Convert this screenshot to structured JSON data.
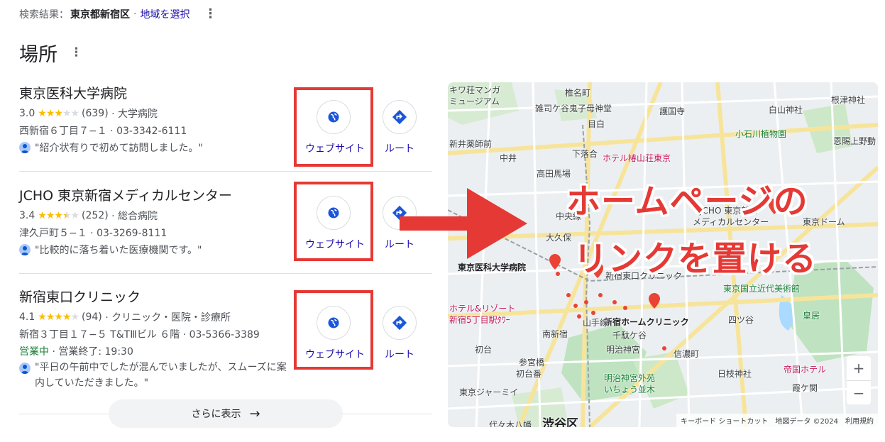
{
  "header": {
    "prefix": "検索結果：",
    "location": "東京都新宿区",
    "separator": "·",
    "region_link": "地域を選択"
  },
  "section": {
    "title": "場所"
  },
  "places": [
    {
      "name": "東京医科大学病院",
      "rating": "3.0",
      "stars": 3.0,
      "reviews": "(639)",
      "category": "· 大学病院",
      "address": "西新宿６丁目７−１ · 03-3342-6111",
      "review": "\"紹介状有りで初めて訪問しました。\""
    },
    {
      "name": "JCHO 東京新宿メディカルセンター",
      "rating": "3.4",
      "stars": 3.5,
      "reviews": "(252)",
      "category": "· 総合病院",
      "address": "津久戸町５−１ · 03-3269-8111",
      "review": "\"比較的に落ち着いた医療機関です。\""
    },
    {
      "name": "新宿東口クリニック",
      "rating": "4.1",
      "stars": 4.0,
      "reviews": "(94)",
      "category": "· クリニック・医院・診療所",
      "address": "新宿３丁目１７−５ T&TⅢビル ６階 · 03-5366-3389",
      "open_status": "営業中",
      "hours": "· 営業終了: 19:30",
      "review": "\"平日の午前中でしたが混んでいましたが、スムーズに案内していただきました。\""
    }
  ],
  "actions": {
    "website": "ウェブサイト",
    "route": "ルート"
  },
  "more": {
    "label": "さらに表示"
  },
  "callout": {
    "line1": "ホームページの",
    "line2": "リンクを置ける"
  },
  "map": {
    "labels": {
      "l01": "キワ荘マンガ",
      "l02": "ミュージアム",
      "l03": "椎名町",
      "l04": "雑司ケ谷鬼子母神堂",
      "l05": "護国寺",
      "l06": "白山神社",
      "l07": "根津神社",
      "l08": "目白",
      "l09": "小石川植物園",
      "l10": "恩賜上野動",
      "l11": "新井薬師前",
      "l12": "中井",
      "l13": "下落合",
      "l14": "ホテル椿山荘東京",
      "l15": "高田馬場",
      "l16": "JCHO 東京新宿",
      "l17": "メディカルセンター",
      "l18": "東京ドーム",
      "l19": "大久保",
      "l20": "東京医科大学病院",
      "l21": "新宿東口クリニック",
      "l22": "東京国立近代美術館",
      "l23": "ホテル&リゾート",
      "l24": "新宿5丁目駅ﾀﾜｰ",
      "l25": "新宿ホームクリニック",
      "l26": "四ツ谷",
      "l27": "南新宿",
      "l28": "千駄ケ谷",
      "l29": "皇居",
      "l30": "初台",
      "l31": "明治神宮",
      "l32": "信濃町",
      "l33": "参宮橋",
      "l34": "初台番",
      "l35": "明治神宮外苑",
      "l36": "いちょう並木",
      "l37": "日枝神社",
      "l38": "帝国ホテル",
      "l39": "東京ジャーミイ",
      "l40": "霞ケ関",
      "l41": "渋谷区",
      "l42": "代々木八幡",
      "l43": "中央線",
      "l44": "山手線"
    },
    "attribution": {
      "keyboard": "キーボード ショートカット",
      "data": "地図データ ©2024",
      "terms": "利用規約"
    },
    "zoom_in": "+",
    "zoom_out": "−"
  }
}
